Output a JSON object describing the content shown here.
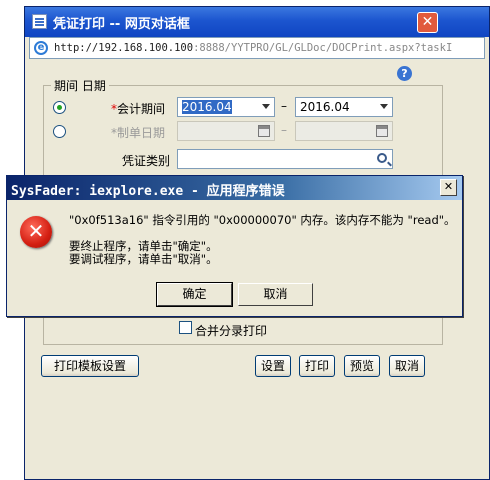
{
  "window": {
    "title": "凭证打印 -- 网页对话框",
    "close_glyph": "✕",
    "address_host": "http://192.168.100.100",
    "address_path": ":8888/YYTPRO/GL/GLDoc/DOCPrint.aspx?taskI"
  },
  "form": {
    "group_label": "期间 日期",
    "required_mark": "*",
    "period_label": "会计期间",
    "period_from": "2016.04",
    "period_dash": "–",
    "period_to": "2016.04",
    "date_label": "制单日期",
    "date_dash": "–",
    "voucher_type_label": "凭证类别",
    "voucher_type_value": "",
    "merge_print_label": "合并分录打印"
  },
  "buttons": {
    "template_settings": "打印模板设置",
    "settings": "设置",
    "print": "打印",
    "preview": "预览",
    "cancel": "取消"
  },
  "error_dialog": {
    "title": "SysFader: iexplore.exe - 应用程序错误",
    "close_glyph": "✕",
    "icon_glyph": "✕",
    "message_line1": "\"0x0f513a16\" 指令引用的 \"0x00000070\" 内存。该内存不能为 \"read\"。",
    "message_line2": "要终止程序，请单击\"确定\"。",
    "message_line3": "要调试程序，请单击\"取消\"。",
    "ok_label": "确定",
    "cancel_label": "取消"
  },
  "icons": {
    "help_glyph": "?",
    "ie_glyph": "e"
  },
  "colors": {
    "title_blue": "#1c55cf",
    "error_red": "#d41f12",
    "dialog_bg": "#ece9d8",
    "selection": "#316ac5"
  }
}
